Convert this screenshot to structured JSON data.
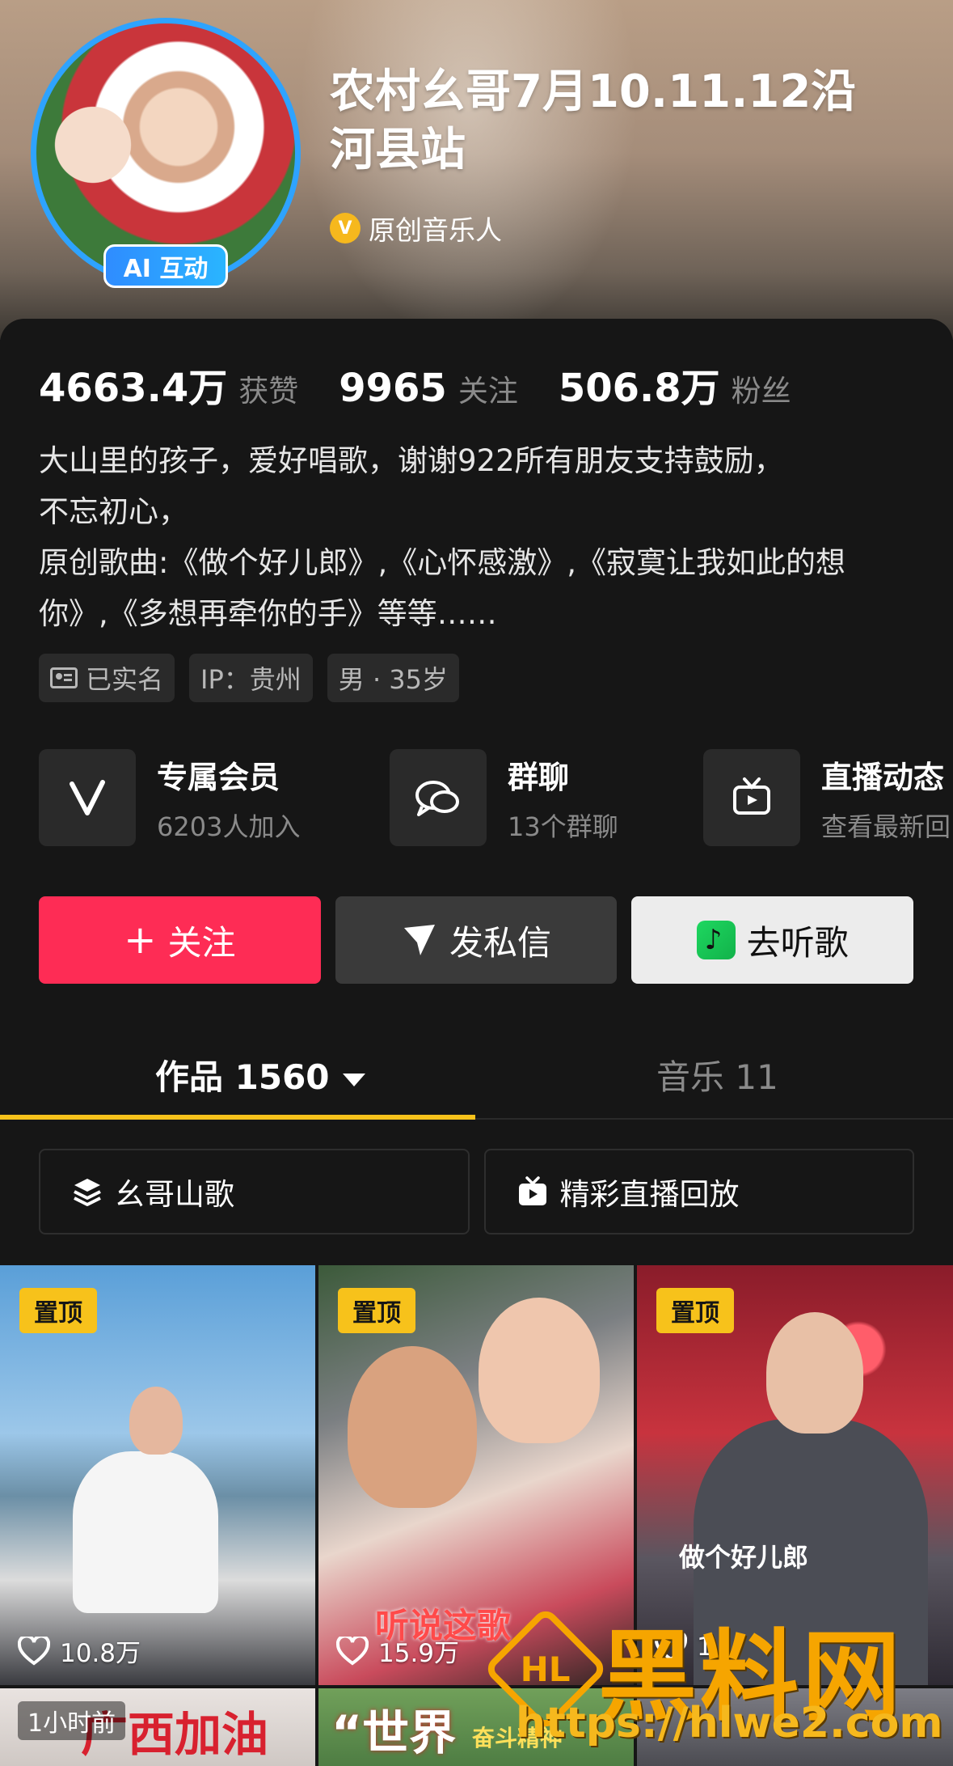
{
  "profile": {
    "name_line1": "农村幺哥7月10.11.12沿",
    "name_line2": "河县站",
    "ai_badge": "AI 互动",
    "verification": "原创音乐人",
    "verify_icon": "v-badge-icon"
  },
  "stats": [
    {
      "value": "4663.4万",
      "label": "获赞"
    },
    {
      "value": "9965",
      "label": "关注"
    },
    {
      "value": "506.8万",
      "label": "粉丝"
    }
  ],
  "bio": [
    "大山里的孩子，爱好唱歌，谢谢922所有朋友支持鼓励，",
    "不忘初心，",
    "原创歌曲:《做个好儿郎》,《心怀感激》,《寂寞让我如此的想",
    "你》,《多想再牵你的手》等等……"
  ],
  "tags": [
    {
      "label": "已实名",
      "icon": "id-card-icon"
    },
    {
      "label": "IP：贵州"
    },
    {
      "label": "男 · 35岁"
    }
  ],
  "features": [
    {
      "title": "专属会员",
      "sub": "6203人加入",
      "icon": "v-icon"
    },
    {
      "title": "群聊",
      "sub": "13个群聊",
      "icon": "chat-bubbles-icon"
    },
    {
      "title": "直播动态",
      "sub": "查看最新回",
      "icon": "tv-icon"
    }
  ],
  "actions": {
    "follow": "关注",
    "message": "发私信",
    "listen": "去听歌"
  },
  "tabs": {
    "works": "作品 1560",
    "music": "音乐 11"
  },
  "collections": [
    {
      "label": "幺哥山歌",
      "icon": "layers-icon"
    },
    {
      "label": "精彩直播回放",
      "icon": "live-tv-icon"
    }
  ],
  "videos": [
    {
      "pinned": "置顶",
      "likes": "10.8万"
    },
    {
      "pinned": "置顶",
      "likes": "15.9万",
      "cover_text": "听说这歌"
    },
    {
      "pinned": "置顶",
      "likes": "1",
      "cover_text": "做个好儿郎"
    },
    {
      "time": "1小时前",
      "cover_text": "广西加油"
    },
    {
      "cover_text": "“世界",
      "cover_text_2": "奋斗精神"
    },
    {}
  ],
  "watermark": {
    "logo": "HL",
    "text": "黑料网",
    "url": "https://hlwe2.com"
  },
  "colors": {
    "follow_button": "#fe2c55",
    "tab_underline": "#f7c21b",
    "ai_badge": "#2f8cff",
    "watermark": "#f6a500"
  }
}
